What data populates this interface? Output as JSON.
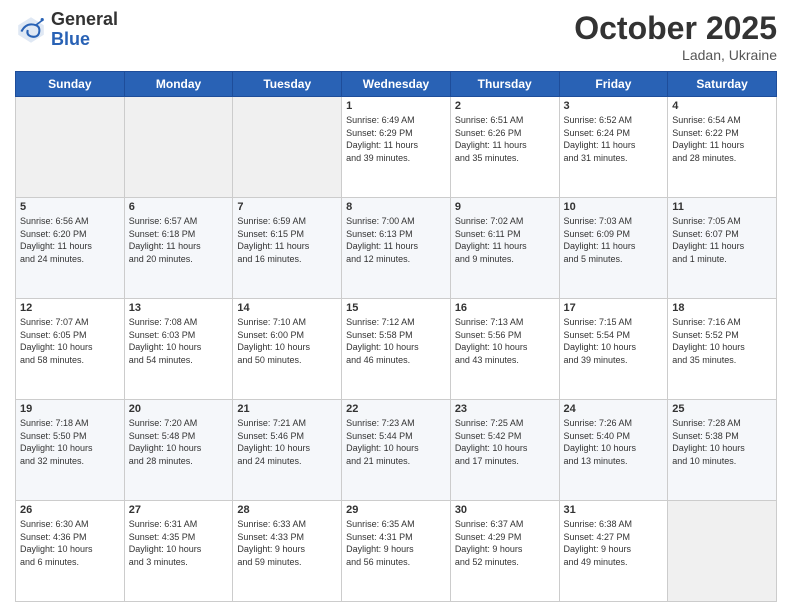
{
  "header": {
    "logo_general": "General",
    "logo_blue": "Blue",
    "month": "October 2025",
    "location": "Ladan, Ukraine"
  },
  "weekdays": [
    "Sunday",
    "Monday",
    "Tuesday",
    "Wednesday",
    "Thursday",
    "Friday",
    "Saturday"
  ],
  "weeks": [
    [
      {
        "day": "",
        "info": ""
      },
      {
        "day": "",
        "info": ""
      },
      {
        "day": "",
        "info": ""
      },
      {
        "day": "1",
        "info": "Sunrise: 6:49 AM\nSunset: 6:29 PM\nDaylight: 11 hours\nand 39 minutes."
      },
      {
        "day": "2",
        "info": "Sunrise: 6:51 AM\nSunset: 6:26 PM\nDaylight: 11 hours\nand 35 minutes."
      },
      {
        "day": "3",
        "info": "Sunrise: 6:52 AM\nSunset: 6:24 PM\nDaylight: 11 hours\nand 31 minutes."
      },
      {
        "day": "4",
        "info": "Sunrise: 6:54 AM\nSunset: 6:22 PM\nDaylight: 11 hours\nand 28 minutes."
      }
    ],
    [
      {
        "day": "5",
        "info": "Sunrise: 6:56 AM\nSunset: 6:20 PM\nDaylight: 11 hours\nand 24 minutes."
      },
      {
        "day": "6",
        "info": "Sunrise: 6:57 AM\nSunset: 6:18 PM\nDaylight: 11 hours\nand 20 minutes."
      },
      {
        "day": "7",
        "info": "Sunrise: 6:59 AM\nSunset: 6:15 PM\nDaylight: 11 hours\nand 16 minutes."
      },
      {
        "day": "8",
        "info": "Sunrise: 7:00 AM\nSunset: 6:13 PM\nDaylight: 11 hours\nand 12 minutes."
      },
      {
        "day": "9",
        "info": "Sunrise: 7:02 AM\nSunset: 6:11 PM\nDaylight: 11 hours\nand 9 minutes."
      },
      {
        "day": "10",
        "info": "Sunrise: 7:03 AM\nSunset: 6:09 PM\nDaylight: 11 hours\nand 5 minutes."
      },
      {
        "day": "11",
        "info": "Sunrise: 7:05 AM\nSunset: 6:07 PM\nDaylight: 11 hours\nand 1 minute."
      }
    ],
    [
      {
        "day": "12",
        "info": "Sunrise: 7:07 AM\nSunset: 6:05 PM\nDaylight: 10 hours\nand 58 minutes."
      },
      {
        "day": "13",
        "info": "Sunrise: 7:08 AM\nSunset: 6:03 PM\nDaylight: 10 hours\nand 54 minutes."
      },
      {
        "day": "14",
        "info": "Sunrise: 7:10 AM\nSunset: 6:00 PM\nDaylight: 10 hours\nand 50 minutes."
      },
      {
        "day": "15",
        "info": "Sunrise: 7:12 AM\nSunset: 5:58 PM\nDaylight: 10 hours\nand 46 minutes."
      },
      {
        "day": "16",
        "info": "Sunrise: 7:13 AM\nSunset: 5:56 PM\nDaylight: 10 hours\nand 43 minutes."
      },
      {
        "day": "17",
        "info": "Sunrise: 7:15 AM\nSunset: 5:54 PM\nDaylight: 10 hours\nand 39 minutes."
      },
      {
        "day": "18",
        "info": "Sunrise: 7:16 AM\nSunset: 5:52 PM\nDaylight: 10 hours\nand 35 minutes."
      }
    ],
    [
      {
        "day": "19",
        "info": "Sunrise: 7:18 AM\nSunset: 5:50 PM\nDaylight: 10 hours\nand 32 minutes."
      },
      {
        "day": "20",
        "info": "Sunrise: 7:20 AM\nSunset: 5:48 PM\nDaylight: 10 hours\nand 28 minutes."
      },
      {
        "day": "21",
        "info": "Sunrise: 7:21 AM\nSunset: 5:46 PM\nDaylight: 10 hours\nand 24 minutes."
      },
      {
        "day": "22",
        "info": "Sunrise: 7:23 AM\nSunset: 5:44 PM\nDaylight: 10 hours\nand 21 minutes."
      },
      {
        "day": "23",
        "info": "Sunrise: 7:25 AM\nSunset: 5:42 PM\nDaylight: 10 hours\nand 17 minutes."
      },
      {
        "day": "24",
        "info": "Sunrise: 7:26 AM\nSunset: 5:40 PM\nDaylight: 10 hours\nand 13 minutes."
      },
      {
        "day": "25",
        "info": "Sunrise: 7:28 AM\nSunset: 5:38 PM\nDaylight: 10 hours\nand 10 minutes."
      }
    ],
    [
      {
        "day": "26",
        "info": "Sunrise: 6:30 AM\nSunset: 4:36 PM\nDaylight: 10 hours\nand 6 minutes."
      },
      {
        "day": "27",
        "info": "Sunrise: 6:31 AM\nSunset: 4:35 PM\nDaylight: 10 hours\nand 3 minutes."
      },
      {
        "day": "28",
        "info": "Sunrise: 6:33 AM\nSunset: 4:33 PM\nDaylight: 9 hours\nand 59 minutes."
      },
      {
        "day": "29",
        "info": "Sunrise: 6:35 AM\nSunset: 4:31 PM\nDaylight: 9 hours\nand 56 minutes."
      },
      {
        "day": "30",
        "info": "Sunrise: 6:37 AM\nSunset: 4:29 PM\nDaylight: 9 hours\nand 52 minutes."
      },
      {
        "day": "31",
        "info": "Sunrise: 6:38 AM\nSunset: 4:27 PM\nDaylight: 9 hours\nand 49 minutes."
      },
      {
        "day": "",
        "info": ""
      }
    ]
  ]
}
